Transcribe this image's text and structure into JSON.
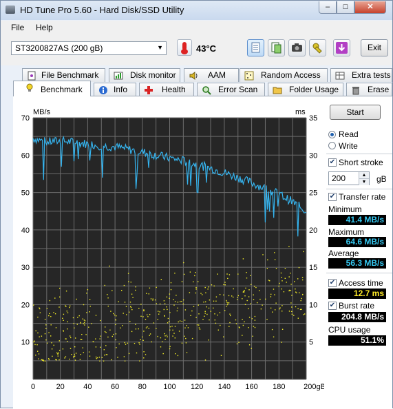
{
  "title": "HD Tune Pro 5.60 - Hard Disk/SSD Utility",
  "menu": [
    "File",
    "Help"
  ],
  "drive": "ST3200827AS (200 gB)",
  "temperature": "43°C",
  "exit_label": "Exit",
  "tabs_top": [
    "File Benchmark",
    "Disk monitor",
    "AAM",
    "Random Access",
    "Extra tests"
  ],
  "tabs_bottom": [
    "Benchmark",
    "Info",
    "Health",
    "Error Scan",
    "Folder Usage",
    "Erase"
  ],
  "start_label": "Start",
  "read_label": "Read",
  "write_label": "Write",
  "short_stroke_label": "Short stroke",
  "short_stroke_value": "200",
  "short_stroke_unit": "gB",
  "transfer_rate_label": "Transfer rate",
  "minimum_label": "Minimum",
  "minimum_value": "41.4 MB/s",
  "maximum_label": "Maximum",
  "maximum_value": "64.6 MB/s",
  "average_label": "Average",
  "average_value": "56.3 MB/s",
  "access_time_label": "Access time",
  "access_time_value": "12.7 ms",
  "burst_rate_label": "Burst rate",
  "burst_rate_value": "204.8 MB/s",
  "cpu_usage_label": "CPU usage",
  "cpu_usage_value": "51.1%",
  "colors": {
    "transfer": "#35b4ef",
    "access": "#f4ee27",
    "plot_bg": "#262626",
    "grid": "#6e6e6e"
  },
  "chart_data": {
    "type": "line",
    "y_left_label": "MB/s",
    "y_right_label": "ms",
    "x_unit": "gB",
    "ylim_left": [
      0,
      70
    ],
    "ylim_right": [
      0,
      35
    ],
    "xlim": [
      0,
      200
    ],
    "x_ticks": [
      "0",
      "20",
      "40",
      "60",
      "80",
      "100",
      "120",
      "140",
      "160",
      "180",
      "200gB"
    ],
    "y_left_ticks": [
      "70",
      "60",
      "50",
      "40",
      "30",
      "20",
      "10"
    ],
    "y_right_ticks": [
      "35",
      "30",
      "25",
      "20",
      "15",
      "10",
      "5"
    ],
    "transfer_rate": {
      "x": [
        0,
        10,
        20,
        30,
        40,
        50,
        60,
        70,
        80,
        90,
        100,
        110,
        120,
        130,
        140,
        150,
        160,
        170,
        180,
        190,
        200
      ],
      "y": [
        64.5,
        63.5,
        63.8,
        63.5,
        63.0,
        62.5,
        62.2,
        61.5,
        60.8,
        60.0,
        59.2,
        58.5,
        57.5,
        56.5,
        55.3,
        54.0,
        52.6,
        51.1,
        49.6,
        47.5,
        45.0
      ]
    },
    "access_time_points": "random scatter ~3–19 ms, trending upward with position"
  }
}
